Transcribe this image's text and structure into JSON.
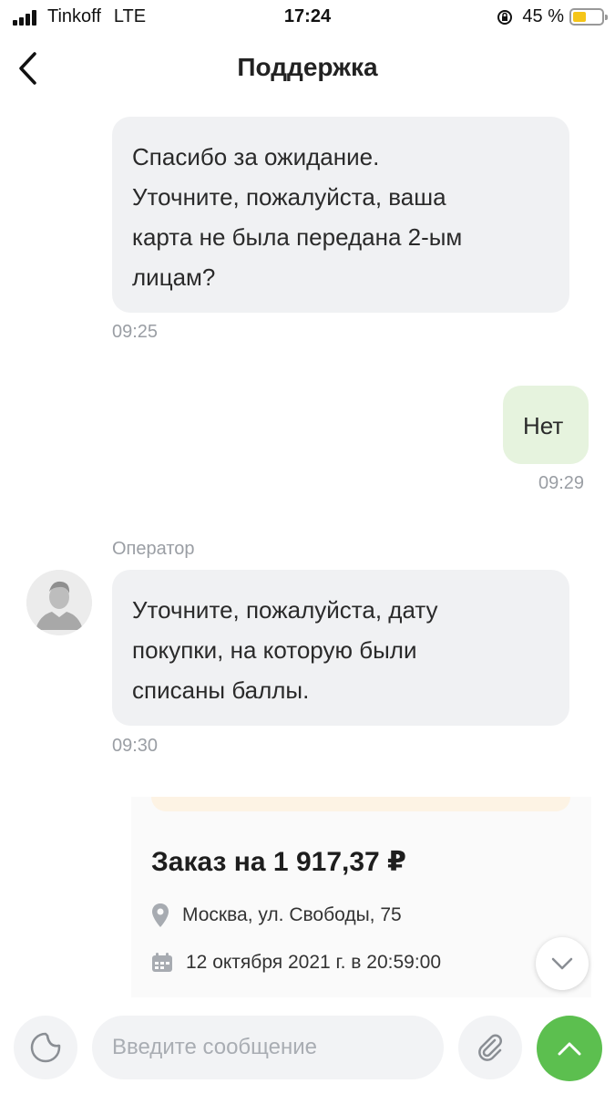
{
  "status_bar": {
    "carrier": "Tinkoff",
    "network": "LTE",
    "time": "17:24",
    "battery": "45 %"
  },
  "nav": {
    "title": "Поддержка"
  },
  "messages": [
    {
      "direction": "incoming",
      "lines": [
        "Спасибо за ожидание.",
        "Уточните, пожалуйста, ваша",
        "карта не была передана 2-ым",
        "лицам?"
      ],
      "time": "09:25"
    },
    {
      "direction": "outgoing",
      "lines": [
        "Нет"
      ],
      "time": "09:29"
    },
    {
      "direction": "incoming",
      "sender": "Оператор",
      "lines": [
        "Уточните, пожалуйста, дату",
        "покупки, на которую были",
        "списаны баллы."
      ],
      "time": "09:30"
    }
  ],
  "order_card": {
    "title": "Заказ на 1 917,37 ₽",
    "address": "Москва, ул. Свободы, 75",
    "datetime": "12 октября 2021 г. в 20:59:00"
  },
  "input": {
    "placeholder": "Введите сообщение"
  },
  "colors": {
    "incoming_bubble": "#f0f1f3",
    "outgoing_bubble": "#e6f3de",
    "send_button": "#5cbf4f",
    "battery_fill": "#f5c518"
  }
}
